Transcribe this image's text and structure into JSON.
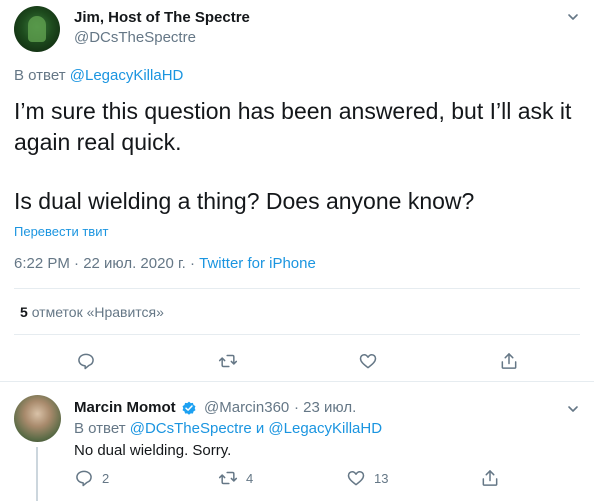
{
  "main_tweet": {
    "author_name": "Jim, Host of The Spectre",
    "author_handle": "@DCsTheSpectre",
    "reply_prefix": "В ответ",
    "reply_to": "@LegacyKillaHD",
    "text_line1": "I’m sure this question has been answered, but I’ll ask it",
    "text_line2": "again real quick.",
    "text_line3": "Is dual wielding a thing? Does anyone know?",
    "translate_label": "Перевести твит",
    "timestamp": "6:22 PM · 22 июл. 2020 г. ·",
    "source": "Twitter for iPhone",
    "likes_count": "5",
    "likes_label": "отметок «Нравится»"
  },
  "reply_tweet": {
    "author_name": "Marcin Momot",
    "author_handle": "@Marcin360",
    "time": "· 23 июл.",
    "reply_prefix": "В ответ",
    "reply_to_1": "@DCsTheSpectre",
    "reply_joiner": "и",
    "reply_to_2": "@LegacyKillaHD",
    "text": "No dual wielding. Sorry.",
    "reply_count": "2",
    "retweet_count": "4",
    "like_count": "13"
  },
  "icons": {
    "reply": "reply-icon",
    "retweet": "retweet-icon",
    "like": "heart-icon",
    "share": "share-icon",
    "more": "chevron-down-icon",
    "verified": "verified-badge-icon"
  },
  "colors": {
    "link": "#1b95e0",
    "secondary_text": "#657786",
    "primary_text": "#14171a",
    "verified": "#1da1f2"
  }
}
